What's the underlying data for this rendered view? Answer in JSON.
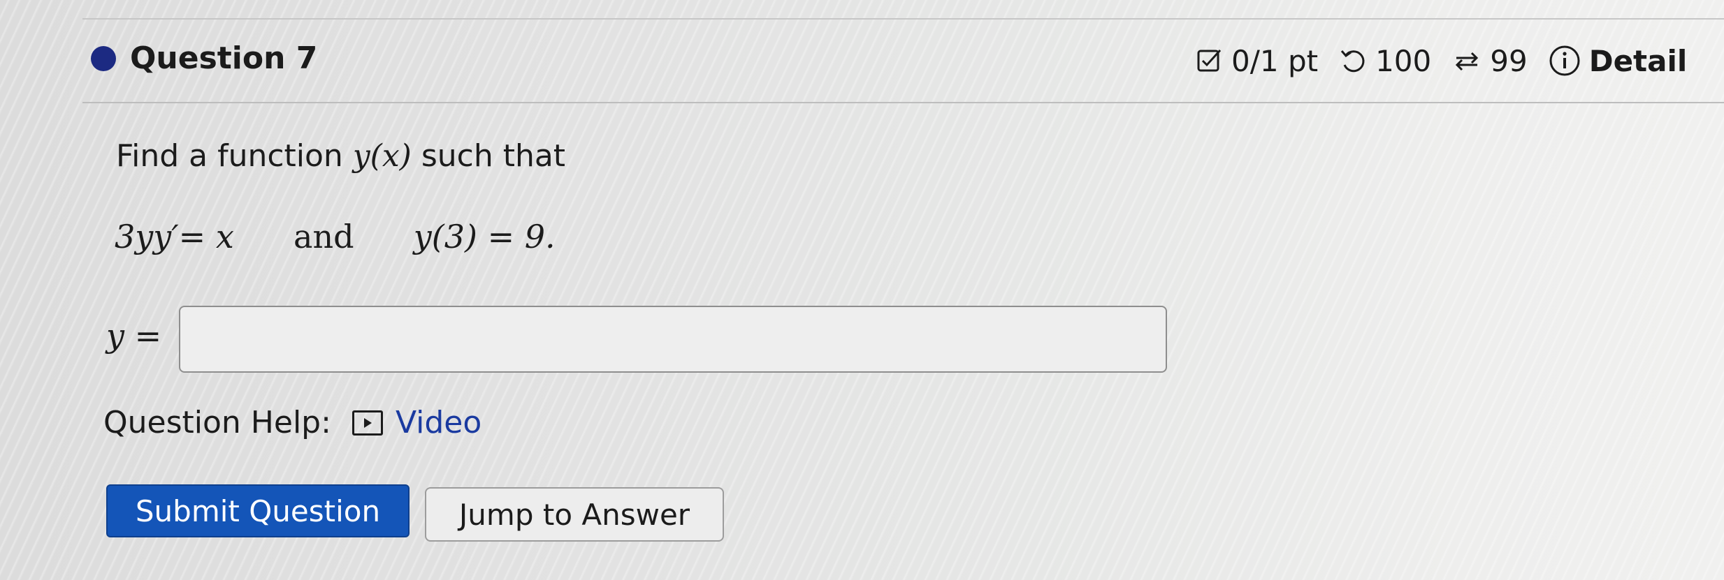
{
  "question": {
    "title": "Question 7",
    "score": "0/1 pt",
    "retries": "100",
    "attempts": "99",
    "details_label": "Detail"
  },
  "problem": {
    "prompt_prefix": "Find a function ",
    "prompt_func": "y(x)",
    "prompt_suffix": " such that",
    "equation_lhs": "3yy′= x",
    "equation_connector": "and",
    "equation_rhs": "y(3) = 9.",
    "answer_label": "y =",
    "answer_value": ""
  },
  "help": {
    "label": "Question Help:",
    "video_label": "Video"
  },
  "buttons": {
    "submit": "Submit Question",
    "jump": "Jump to Answer"
  },
  "colors": {
    "accent": "#1455b8",
    "dot": "#1c2a82",
    "link": "#1a3aa0"
  },
  "icons": {
    "score": "checkbox-pencil-icon",
    "retries": "undo-icon",
    "attempts": "retry-arrows-icon",
    "details": "info-icon",
    "video": "play-icon"
  }
}
